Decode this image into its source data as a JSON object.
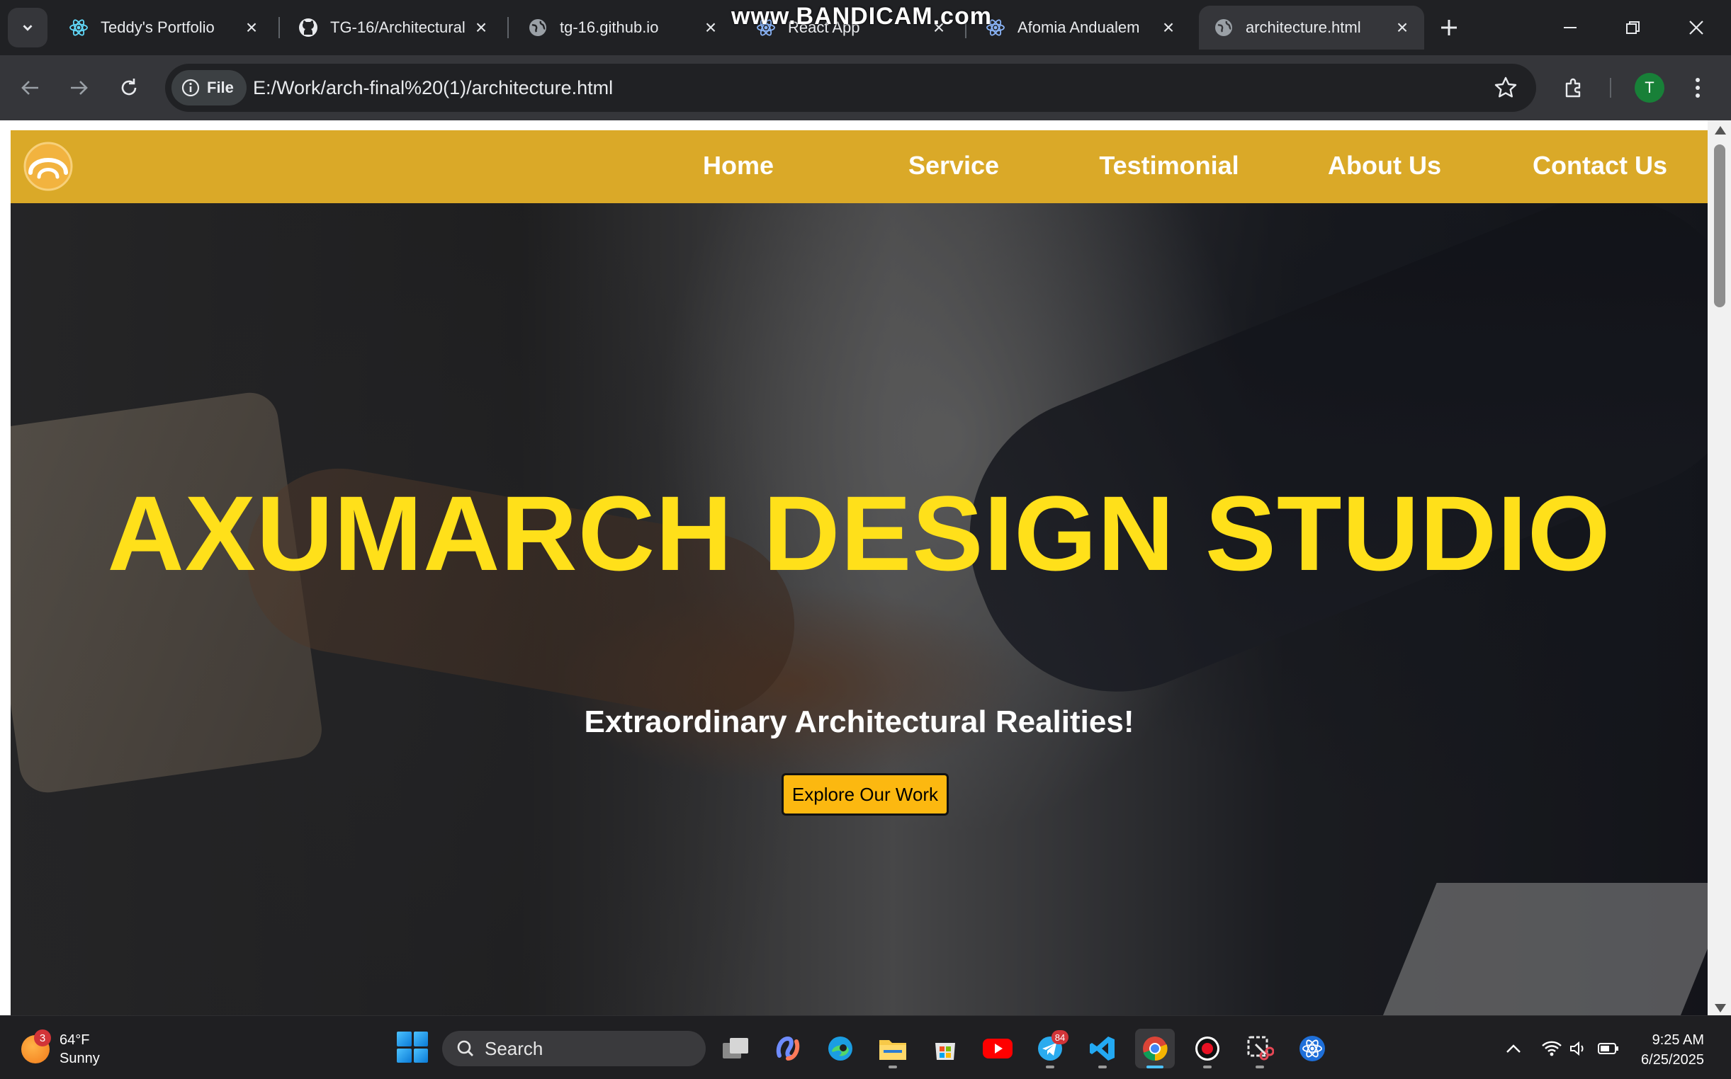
{
  "browser": {
    "watermark": "www.BANDICAM.com",
    "tabs": [
      {
        "title": "Teddy's Portfolio",
        "icon": "react-icon",
        "active": false
      },
      {
        "title": "TG-16/Architectural",
        "icon": "github-icon",
        "active": false
      },
      {
        "title": "tg-16.github.io",
        "icon": "globe-icon",
        "active": false
      },
      {
        "title": "React App",
        "icon": "react-icon",
        "active": false
      },
      {
        "title": "Afomia Andualem",
        "icon": "react-icon",
        "active": false
      },
      {
        "title": "architecture.html",
        "icon": "globe-icon",
        "active": true
      }
    ],
    "address": {
      "chip_label": "File",
      "url": "E:/Work/arch-final%20(1)/architecture.html"
    },
    "profile_initial": "T",
    "colors": {
      "frame": "#202124",
      "toolbar": "#35363a",
      "profile": "#188038"
    }
  },
  "site": {
    "nav": {
      "items": [
        "Home",
        "Service",
        "Testimonial",
        "About Us",
        "Contact Us"
      ],
      "color": "#daa928"
    },
    "hero": {
      "title": "AXUMARCH DESIGN STUDIO",
      "subtitle": "Extraordinary Architectural Realities!",
      "cta_label": "Explore Our Work",
      "title_color": "#ffe01a",
      "cta_color": "#fcb810"
    }
  },
  "taskbar": {
    "weather": {
      "badge": "3",
      "temp": "64°F",
      "condition": "Sunny"
    },
    "search_label": "Search",
    "apps": [
      "task-view",
      "copilot",
      "edge",
      "file-explorer",
      "microsoft-store",
      "youtube",
      "telegram",
      "vscode",
      "chrome",
      "recorder",
      "snipping-tool",
      "react-devtools"
    ],
    "telegram_badge": "84",
    "clock": {
      "time": "9:25 AM",
      "date": "6/25/2025"
    }
  }
}
